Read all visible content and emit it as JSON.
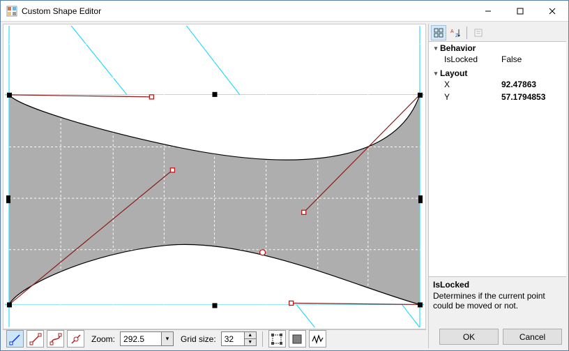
{
  "window": {
    "title": "Custom Shape Editor"
  },
  "toolbar": {
    "zoom_label": "Zoom:",
    "zoom_value": "292.5",
    "grid_label": "Grid size:",
    "grid_value": "32"
  },
  "propertygrid": {
    "behavior": {
      "label": "Behavior",
      "isLocked_label": "IsLocked",
      "isLocked_value": "False"
    },
    "layout": {
      "label": "Layout",
      "x_label": "X",
      "x_value": "92.47863",
      "y_label": "Y",
      "y_value": "57.1794853"
    },
    "description": {
      "title": "IsLocked",
      "body": "Determines if the current point could be moved or not."
    }
  },
  "buttons": {
    "ok": "OK",
    "cancel": "Cancel"
  },
  "colors": {
    "cyan": "#00d5ff",
    "shape_fill": "#aeaeae",
    "control_line": "#8b1a1a"
  }
}
